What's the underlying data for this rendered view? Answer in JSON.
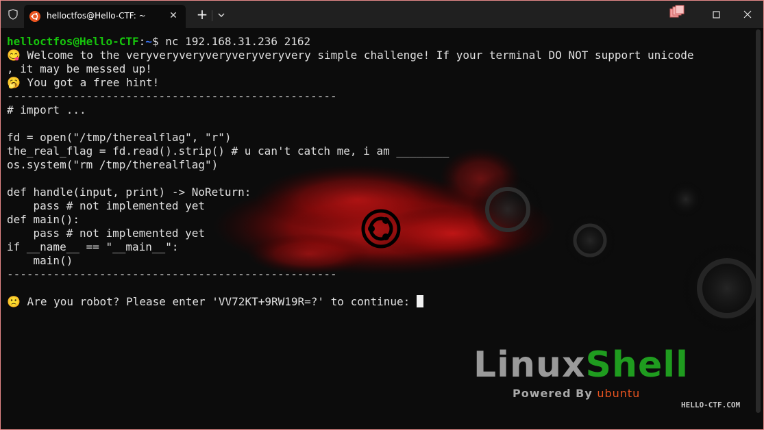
{
  "titlebar": {
    "tab_title": "helloctfos@Hello-CTF: ~",
    "tab_close": "✕",
    "new_tab": "+"
  },
  "prompt": {
    "user_host": "helloctfos@Hello-CTF",
    "colon": ":",
    "path": "~",
    "dollar": "$",
    "command": " nc 192.168.31.236 2162"
  },
  "output": [
    "😋 Welcome to the veryveryveryveryveryveryvery simple challenge! If your terminal DO NOT support unicode",
    ", it may be messed up!",
    "🥱 You got a free hint!",
    "--------------------------------------------------",
    "# import ...",
    "",
    "fd = open(\"/tmp/therealflag\", \"r\")",
    "the_real_flag = fd.read().strip() # u can't catch me, i am ________",
    "os.system(\"rm /tmp/therealflag\")",
    "",
    "def handle(input, print) -> NoReturn:",
    "    pass # not implemented yet",
    "def main():",
    "    pass # not implemented yet",
    "if __name__ == \"__main__\":",
    "    main()",
    "--------------------------------------------------",
    ""
  ],
  "input_prompt": "🙁 Are you robot? Please enter 'VV72KT+9RW19R=?' to continue: ",
  "background": {
    "brand_linux": "Linux",
    "brand_shell": "Shell",
    "powered_by": "Powered By ",
    "powered_ubuntu": "ubuntu",
    "site": "HELLO-CTF.COM"
  },
  "colors": {
    "terminal_bg": "#0c0c0c",
    "prompt_user": "#16c60c",
    "prompt_path": "#3b78ff",
    "ubuntu_orange": "#e95420",
    "window_border": "#e98a8a"
  },
  "icons": [
    "shield-icon",
    "ubuntu-icon",
    "close-icon",
    "plus-icon",
    "chevron-down-icon",
    "minimize-icon",
    "maximize-icon",
    "window-close-icon"
  ]
}
